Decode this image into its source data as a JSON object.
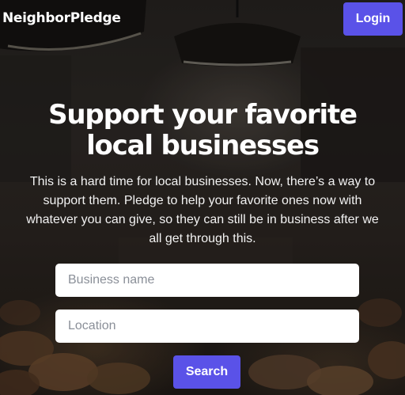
{
  "header": {
    "brand": "NeighborPledge",
    "login_label": "Login"
  },
  "hero": {
    "headline": "Support your favorite local businesses",
    "description": "This is a hard time for local businesses. Now, there’s a way to support them. Pledge to help your favorite ones now with whatever you can give, so they can still be in business after we all get through this."
  },
  "search_form": {
    "business_placeholder": "Business name",
    "business_value": "",
    "location_placeholder": "Location",
    "location_value": "",
    "search_label": "Search"
  },
  "colors": {
    "accent": "#5a52e8",
    "field_background": "#ffffff",
    "text": "#ffffff"
  }
}
